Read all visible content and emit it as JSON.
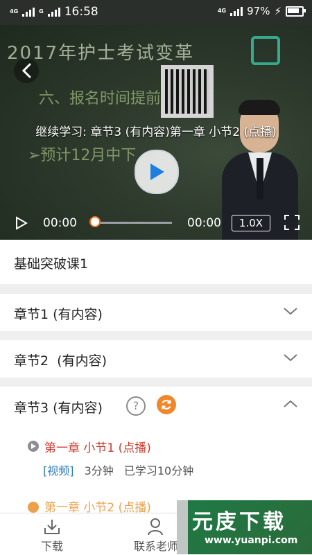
{
  "status_bar": {
    "network_left": "4G",
    "network_left2": "G",
    "time": "16:58",
    "network_right": "4G",
    "battery_percent": "97%",
    "battery_level": 0.97
  },
  "video": {
    "title": "继续学习: 章节3 (有内容)第一章 小节2 (点播)",
    "board_title": "2017年护士考试变革",
    "board_line1": "六、报名时间提前",
    "board_line2": "➢预计12月中下",
    "current_time": "00:00",
    "total_time": "00:00",
    "speed": "1.0X",
    "progress": 0
  },
  "course": {
    "title": "基础突破课1"
  },
  "chapters": [
    {
      "label": "章节1 (有内容)",
      "expanded": false
    },
    {
      "label": "章节2  (有内容)",
      "expanded": false
    },
    {
      "label": "章节3 (有内容)",
      "expanded": true
    }
  ],
  "chapter3": {
    "help_symbol": "?",
    "lessons": [
      {
        "title": "第一章 小节1 (点播)",
        "tag": "[视频]",
        "duration": "3分钟",
        "studied": "已学习10分钟"
      },
      {
        "title": "第一章 小节2 (点播)"
      }
    ]
  },
  "bottom_nav": {
    "download": "下载",
    "contact": "联系老师"
  },
  "watermark": {
    "cn": "元庋下载",
    "url": "www.yuanpi.com"
  },
  "colors": {
    "accent_orange": "#f0882a",
    "lesson_red": "#d0372b",
    "tag_blue": "#2b7bbf"
  }
}
